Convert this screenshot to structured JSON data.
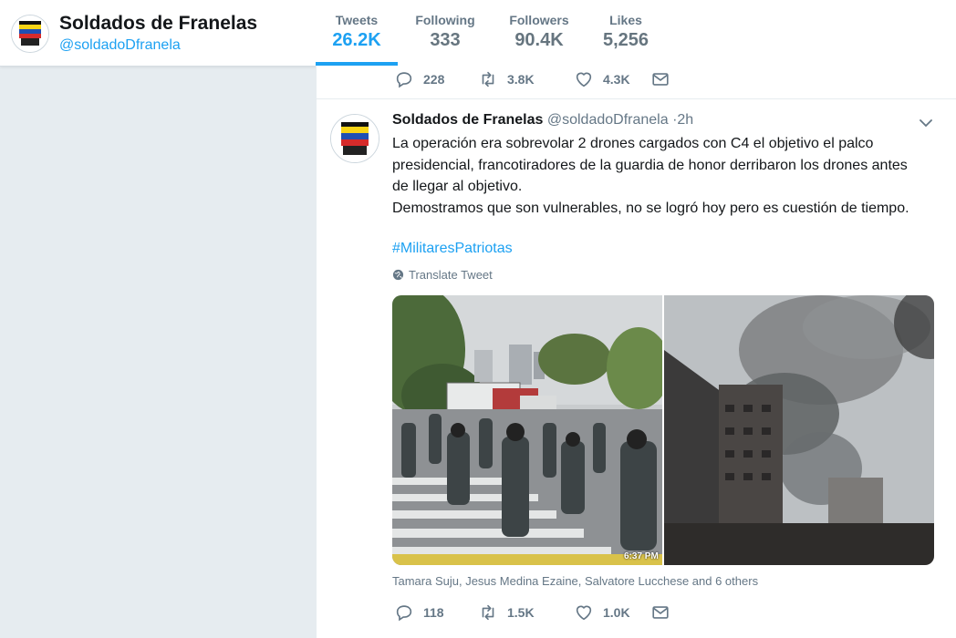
{
  "profile": {
    "name": "Soldados de Franelas",
    "handle": "@soldadoDfranela"
  },
  "stats": [
    {
      "label": "Tweets",
      "value": "26.2K"
    },
    {
      "label": "Following",
      "value": "333"
    },
    {
      "label": "Followers",
      "value": "90.4K"
    },
    {
      "label": "Likes",
      "value": "5,256"
    }
  ],
  "prev_tweet": {
    "replies": "228",
    "retweets": "3.8K",
    "likes": "4.3K"
  },
  "tweet": {
    "name": "Soldados de Franelas",
    "handle": "@soldadoDfranela",
    "dot": "·",
    "time": "2h",
    "lines": [
      "La operación era sobrevolar 2 drones cargados con C4 el objetivo el palco",
      "presidencial, francotiradores de la guardia de honor derribaron los drones antes",
      "de llegar al objetivo.",
      "Demostramos que son vulnerables, no se logró hoy pero es cuestión de tiempo."
    ],
    "hashtag": "#MilitaresPatriotas",
    "translate": "Translate Tweet",
    "photo_time": "6:37 PM",
    "tagged": "Tamara Suju, Jesus Medina Ezaine, Salvatore Lucchese and 6 others",
    "replies": "118",
    "retweets": "1.5K",
    "likes": "1.0K"
  },
  "icons": {
    "reply": "reply-icon",
    "retweet": "retweet-icon",
    "like": "heart-icon",
    "dm": "envelope-icon",
    "caret": "chevron-down-icon",
    "globe": "globe-icon"
  },
  "colors": {
    "accent": "#1da1f2",
    "muted": "#657786",
    "background": "#e6ecf0"
  }
}
